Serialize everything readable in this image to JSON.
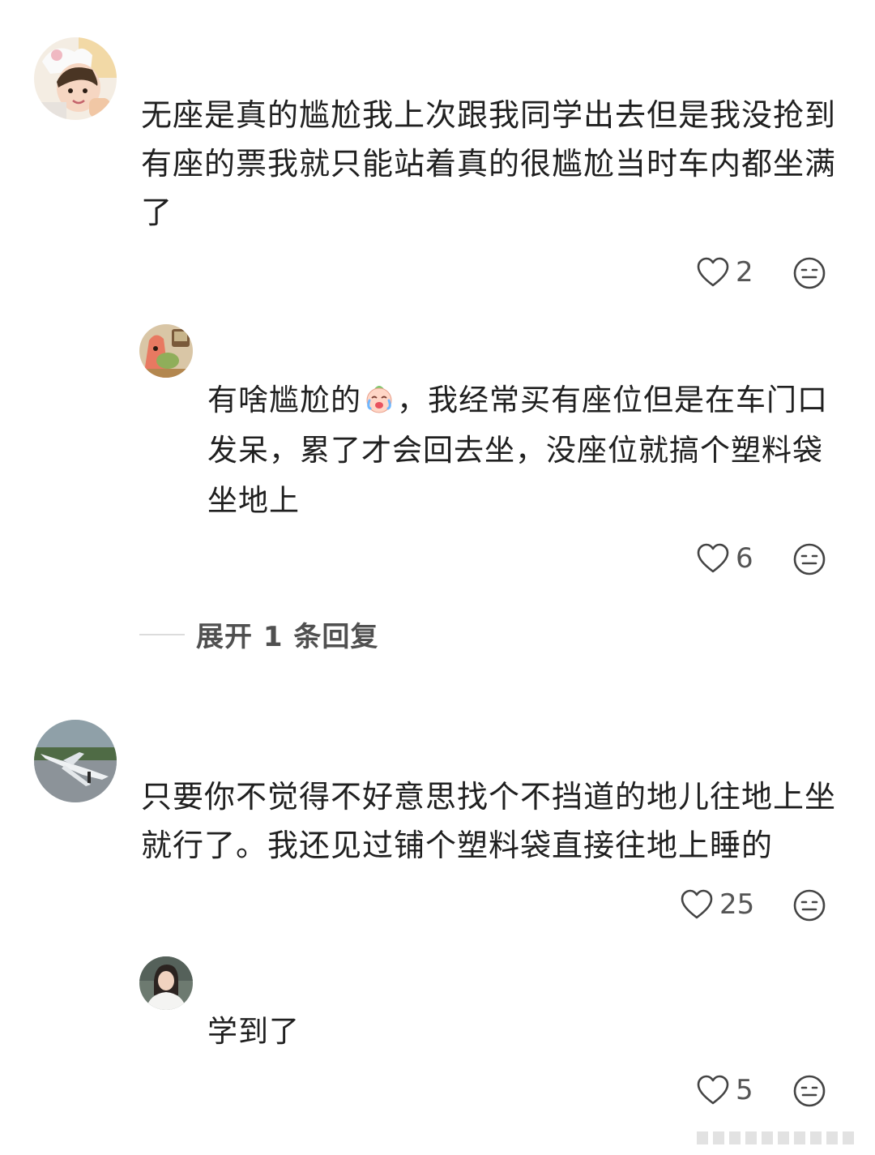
{
  "comments": [
    {
      "text": "无座是真的尴尬我上次跟我同学出去但是我没抢到有座的票我就只能站着真的很尴尬当时车内都坐满了",
      "likes": "2",
      "reply": {
        "text_before": "有啥尴尬的",
        "emoji": "crying-laughing-baby-emoji",
        "text_after": "，我经常买有座位但是在车门口发呆，累了才会回去坐，没座位就搞个塑料袋坐地上",
        "likes": "6"
      },
      "expand_label": "展开 1 条回复"
    },
    {
      "text": "只要你不觉得不好意思找个不挡道的地儿往地上坐就行了。我还见过铺个塑料袋直接往地上睡的",
      "likes": "25",
      "reply": {
        "text": "学到了",
        "likes": "5"
      }
    }
  ],
  "icons": {
    "like": "heart-outline-icon",
    "react": "neutral-face-icon"
  },
  "colors": {
    "text": "#202020",
    "muted": "#555555",
    "icon": "#444444"
  }
}
